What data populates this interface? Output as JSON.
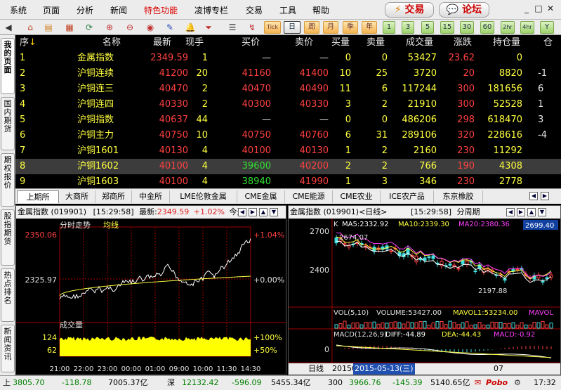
{
  "menu": {
    "items": [
      "系统",
      "页面",
      "分析",
      "新闻",
      "特色功能",
      "凌博专栏",
      "交易",
      "工具",
      "帮助"
    ],
    "trade_button": "交易",
    "forum_button": "论坛"
  },
  "toolbar": {
    "tick_label": "Tick",
    "periods": [
      "日",
      "周",
      "月",
      "季",
      "年",
      "1",
      "3",
      "5",
      "15",
      "30",
      "60",
      "2hr",
      "4hr",
      "Y"
    ]
  },
  "left_tabs": [
    "我的页面",
    "国内期货",
    "期权报价",
    "股指期货",
    "热点排名",
    "新闻资讯"
  ],
  "quotes": {
    "headers": [
      "序",
      "名称",
      "最新",
      "现手",
      "买价",
      "卖价",
      "买量",
      "卖量",
      "成交量",
      "涨跌",
      "持仓量",
      "仓"
    ],
    "rows": [
      {
        "seq": "1",
        "name": "金属指数",
        "last": "2349.59",
        "hand": "1",
        "bid": "—",
        "ask": "—",
        "bidv": "0",
        "askv": "0",
        "vol": "53427",
        "chg": "23.62",
        "oi": "0",
        "extra": ""
      },
      {
        "seq": "2",
        "name": "沪铜连续",
        "last": "41200",
        "hand": "20",
        "bid": "41160",
        "ask": "41400",
        "bidv": "10",
        "askv": "25",
        "vol": "3720",
        "chg": "20",
        "oi": "8820",
        "extra": "-1"
      },
      {
        "seq": "3",
        "name": "沪铜连三",
        "last": "40470",
        "hand": "2",
        "bid": "40470",
        "ask": "40490",
        "bidv": "11",
        "askv": "6",
        "vol": "117244",
        "chg": "300",
        "oi": "181656",
        "extra": "6"
      },
      {
        "seq": "4",
        "name": "沪铜连四",
        "last": "40330",
        "hand": "2",
        "bid": "40300",
        "ask": "40330",
        "bidv": "3",
        "askv": "2",
        "vol": "21910",
        "chg": "300",
        "oi": "52528",
        "extra": "1"
      },
      {
        "seq": "5",
        "name": "沪铜指数",
        "last": "40637",
        "hand": "44",
        "bid": "—",
        "ask": "—",
        "bidv": "0",
        "askv": "0",
        "vol": "486206",
        "chg": "298",
        "oi": "618470",
        "extra": "3"
      },
      {
        "seq": "6",
        "name": "沪铜主力",
        "last": "40750",
        "hand": "10",
        "bid": "40750",
        "ask": "40760",
        "bidv": "6",
        "askv": "31",
        "vol": "289106",
        "chg": "320",
        "oi": "228616",
        "extra": "-4"
      },
      {
        "seq": "7",
        "name": "沪铜1601",
        "last": "40130",
        "hand": "4",
        "bid": "40100",
        "ask": "40130",
        "bidv": "1",
        "askv": "2",
        "vol": "2160",
        "chg": "230",
        "oi": "11292",
        "extra": ""
      },
      {
        "seq": "8",
        "name": "沪铜1602",
        "last": "40100",
        "hand": "4",
        "bid": "39600",
        "ask": "40200",
        "bidv": "2",
        "askv": "2",
        "vol": "766",
        "chg": "190",
        "oi": "4308",
        "extra": ""
      },
      {
        "seq": "9",
        "name": "沪铜1603",
        "last": "40100",
        "hand": "4",
        "bid": "38940",
        "ask": "41990",
        "bidv": "1",
        "askv": "3",
        "vol": "346",
        "chg": "230",
        "oi": "2778",
        "extra": ""
      }
    ]
  },
  "exchange_tabs": [
    "上期所",
    "大商所",
    "郑商所",
    "中金所",
    "LME伦敦金属",
    "CME金属",
    "CME能源",
    "CME农业",
    "ICE农产品",
    "东京橡胶"
  ],
  "intraday": {
    "title": "金属指数 (019901)",
    "time": "[15:29:58]",
    "last_label": "最新:",
    "last_value": "2349.59",
    "change": "+1.02%",
    "today_label": "今开",
    "chart_label": "分时走势",
    "avg_label": "均线",
    "price_high": "2350.06",
    "price_mid": "2325.97",
    "pct_high": "+1.04%",
    "pct_mid": "+0.00%",
    "vol_label": "成交量",
    "vol_high": "124",
    "vol_mid": "62",
    "vol_pct_high": "+100%",
    "vol_pct_mid": "+50%",
    "time_ticks": [
      "21:00",
      "22:00",
      "23:00",
      "00:00",
      "01:00",
      "09:00",
      "10:00",
      "11:30",
      "14:30"
    ]
  },
  "kline": {
    "title": "金属指数 (019901)<日线>",
    "time": "[15:29:58]",
    "period_label": "分周期",
    "k_label": "K",
    "ma5": "MA5:2332.92",
    "ma10": "MA10:2339.30",
    "ma20": "MA20:2380.36",
    "price_box": "2699.40",
    "y_high": "2700",
    "y_mid": "2400",
    "peak_label": "2674.07",
    "low_label": "2197.88",
    "vol_text": "VOL(5,10)",
    "volume": "VOLUME:53427.00",
    "mavol1": "MAVOL1:53234.00",
    "mavol2": "MAVOL",
    "macd_text": "MACD(12,26,9)",
    "diff": "DIFF:-44.89",
    "dea": "DEA:-44.43",
    "macd": "MACD:-0.92",
    "macd_zero": "0",
    "period_tab": "日线",
    "date_start": "20150",
    "date_selected": "2015-05-13(三)",
    "date_end": "07"
  },
  "status": {
    "idx1_value": "3805.70",
    "idx1_chg": "-118.78",
    "idx1_amt": "7005.37亿",
    "idx2_label": "深",
    "idx2_value": "12132.42",
    "idx2_chg": "-596.09",
    "idx2_amt": "5455.34亿",
    "idx3_label": "300",
    "idx3_value": "3966.76",
    "idx3_chg": "-145.39",
    "idx3_amt": "5140.65亿",
    "brand": "Pobo",
    "clock": "17:32"
  },
  "colors": {
    "up": "#ff4040",
    "down": "#30e030",
    "neutral": "#e6e6e6",
    "ma5": "#ffffff",
    "ma10": "#ffff40",
    "ma20": "#ff40ff"
  }
}
